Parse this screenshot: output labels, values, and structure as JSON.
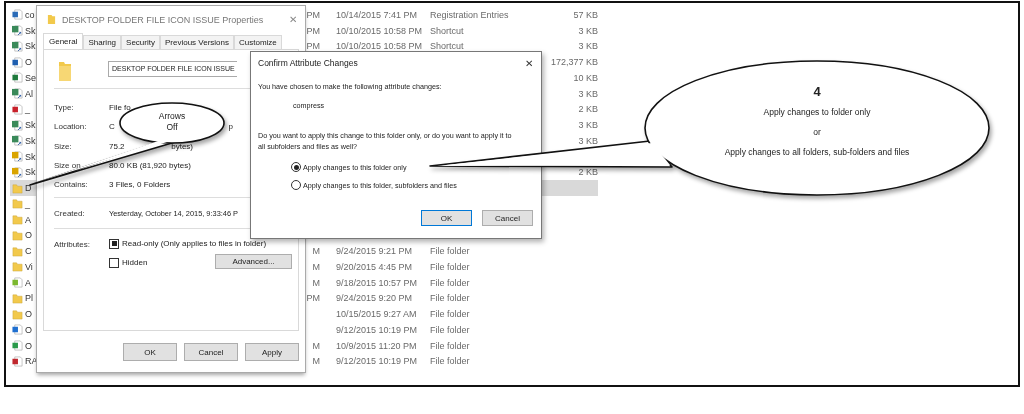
{
  "explorer": {
    "rows": [
      {
        "name": "co",
        "kind": "file",
        "color": "#2b6cb8",
        "time": "PM",
        "date": "10/14/2015 7:41 PM",
        "type": "Registration Entries",
        "size": "57 KB",
        "selected": false
      },
      {
        "name": "Sk",
        "kind": "shortcut",
        "color": "#3a8a5a",
        "time": "PM",
        "date": "10/10/2015 10:58 PM",
        "type": "Shortcut",
        "size": "3 KB",
        "selected": false
      },
      {
        "name": "Sk",
        "kind": "shortcut",
        "color": "#3a8a5a",
        "time": "PM",
        "date": "10/10/2015 10:58 PM",
        "type": "Shortcut",
        "size": "3 KB",
        "selected": false
      },
      {
        "name": "O",
        "kind": "file",
        "color": "#1f5fb0",
        "size": "172,377 KB",
        "selected": false
      },
      {
        "name": "Se",
        "kind": "file",
        "color": "#1e7a3c",
        "size": "10 KB",
        "selected": false
      },
      {
        "name": "Al",
        "kind": "shortcut",
        "color": "#3a8a5a",
        "size": "3 KB",
        "selected": false
      },
      {
        "name": "_",
        "kind": "file",
        "color": "#c8202a",
        "size": "2 KB",
        "selected": false
      },
      {
        "name": "Sk",
        "kind": "shortcut",
        "color": "#3a8a5a",
        "size": "3 KB",
        "selected": false
      },
      {
        "name": "Sk",
        "kind": "shortcut",
        "color": "#3a8a5a",
        "size": "3 KB",
        "selected": false
      },
      {
        "name": "Sk",
        "kind": "shortcut",
        "color": "#d9a400",
        "selected": false
      },
      {
        "name": "Sk",
        "kind": "shortcut",
        "color": "#d9a400",
        "size": "2 KB",
        "selected": false
      },
      {
        "name": "D",
        "kind": "folder",
        "color": "#f2c94c",
        "selected": true
      },
      {
        "name": "_",
        "kind": "folder",
        "color": "#f2c94c",
        "selected": false
      },
      {
        "name": "A",
        "kind": "folder",
        "color": "#f2c94c",
        "selected": false
      },
      {
        "name": "O",
        "kind": "folder",
        "color": "#f2c94c",
        "selected": false
      },
      {
        "name": "C",
        "kind": "folder",
        "color": "#f2c94c",
        "time": "M",
        "date": "9/24/2015 9:21 PM",
        "type": "File folder",
        "selected": false
      },
      {
        "name": "Vi",
        "kind": "folder",
        "color": "#f2c94c",
        "time": "M",
        "date": "9/20/2015 4:45 PM",
        "type": "File folder",
        "selected": false
      },
      {
        "name": "A",
        "kind": "file",
        "color": "#7cb82f",
        "time": "M",
        "date": "9/18/2015 10:57 PM",
        "type": "File folder",
        "selected": false
      },
      {
        "name": "Pl",
        "kind": "folder",
        "color": "#f2c94c",
        "time": "PM",
        "date": "9/24/2015 9:20 PM",
        "type": "File folder",
        "selected": false
      },
      {
        "name": "O",
        "kind": "folder",
        "color": "#f2c94c",
        "date": "10/15/2015 9:27 AM",
        "type": "File folder",
        "selected": false
      },
      {
        "name": "O",
        "kind": "file",
        "color": "#1f6fd0",
        "date": "9/12/2015 10:19 PM",
        "type": "File folder",
        "selected": false
      },
      {
        "name": "O",
        "kind": "file",
        "color": "#2a9a4a",
        "time": "M",
        "date": "10/9/2015 11:20 PM",
        "type": "File folder",
        "selected": false
      },
      {
        "name": "RA",
        "kind": "file",
        "color": "#c0282e",
        "time": "M",
        "date": "9/12/2015 10:19 PM",
        "type": "File folder",
        "selected": false
      }
    ]
  },
  "properties": {
    "title": "DESKTOP FOLDER FILE ICON ISSUE Properties",
    "close": "✕",
    "tabs": [
      {
        "label": "General",
        "selected": true
      },
      {
        "label": "Sharing",
        "selected": false
      },
      {
        "label": "Security",
        "selected": false
      },
      {
        "label": "Previous Versions",
        "selected": false
      },
      {
        "label": "Customize",
        "selected": false
      }
    ],
    "name": "DESKTOP FOLDER FILE ICON ISSUE",
    "details": [
      {
        "label": "Type:",
        "value": "File fo"
      },
      {
        "label": "Location:",
        "value": "C",
        "value_tail": "p"
      },
      {
        "label": "Size:",
        "value": "75.2",
        "value_tail": "bytes)"
      },
      {
        "label": "Size on",
        "value": "80.0 KB (81,920 bytes)"
      },
      {
        "label": "Contains:",
        "value": "3 Files, 0 Folders"
      }
    ],
    "created": {
      "label": "Created:",
      "value": "Yesterday, October 14, 2015, 9:33:46 P"
    },
    "attributes": {
      "label": "Attributes:",
      "options": [
        {
          "label": "Read-only (Only applies to files in folder)",
          "checked": true
        },
        {
          "label": "Hidden",
          "checked": false
        }
      ],
      "advanced": "Advanced..."
    },
    "buttons": [
      "OK",
      "Cancel",
      "Apply"
    ]
  },
  "confirm": {
    "title": "Confirm Attribute Changes",
    "close": "✕",
    "intro": "You have chosen to make the following attribute changes:",
    "change": "compress",
    "question": "Do you want to apply this change to this folder only, or do you want to apply it to all subfolders and files as well?",
    "options": [
      {
        "label": "Apply changes to this folder only",
        "selected": true
      },
      {
        "label": "Apply changes to this folder, subfolders and files",
        "selected": false
      }
    ],
    "buttons": [
      "OK",
      "Cancel"
    ]
  },
  "callouts": [
    {
      "lines": [
        "Arrows",
        "Off"
      ]
    },
    {
      "number": "4",
      "lines": [
        "Apply changes to folder only",
        "or",
        "Apply changes to all folders, sub-folders and files"
      ]
    }
  ]
}
